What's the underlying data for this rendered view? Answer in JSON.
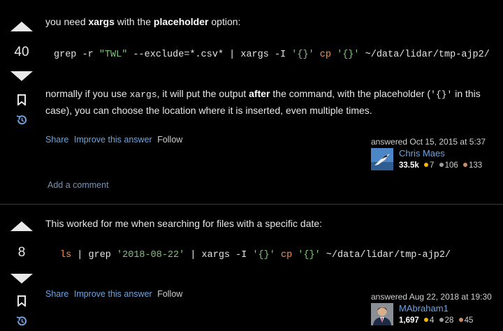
{
  "answers": [
    {
      "votes": "40",
      "intro": {
        "t1": "you need ",
        "b1": "xargs",
        "t2": " with the ",
        "b2": "placeholder",
        "t3": " option:"
      },
      "code": {
        "p1": "grep -r ",
        "s1": "\"TWL\"",
        "p2": " --exclude=*.csv* | xargs -I ",
        "s2": "'{}'",
        "sp": " ",
        "k1": "cp",
        "sp2": " ",
        "s3": "'{}'",
        "p3": " ~/data/lidar/tmp-ajp2/"
      },
      "body": {
        "t1": "normally if you use ",
        "c1": "xargs",
        "t2": ", it will put the output ",
        "b1": "after",
        "t3": " the command, with the placeholder (",
        "c2": "'{}'",
        "t4": " in this case), you can choose the location where it is inserted, even multiple times."
      },
      "menu": {
        "share": "Share",
        "improve": "Improve this answer",
        "follow": "Follow"
      },
      "user": {
        "action": "answered Oct 15, 2015 at 5:37",
        "name": "Chris Maes",
        "rep": "33.5k",
        "gold": "7",
        "silver": "106",
        "bronze": "133"
      },
      "add_comment": "Add a comment"
    },
    {
      "votes": "8",
      "text": "This worked for me when searching for files with a specific date:",
      "code": {
        "k0": "ls",
        "p1": " | grep ",
        "s1": "'2018-08-22'",
        "p2": " | xargs -I ",
        "s2": "'{}'",
        "sp": " ",
        "k1": "cp",
        "sp2": " ",
        "s3": "'{}'",
        "p3": " ~/data/lidar/tmp-ajp2/"
      },
      "menu": {
        "share": "Share",
        "improve": "Improve this answer",
        "follow": "Follow"
      },
      "user": {
        "action": "answered Aug 22, 2018 at 19:30",
        "name": "MAbraham1",
        "rep": "1,697",
        "gold": "4",
        "silver": "28",
        "bronze": "45"
      }
    }
  ],
  "colors": {
    "gold": "#f1b600",
    "silver": "#9a9da0",
    "bronze": "#c88e63",
    "link": "#6fa4e0"
  }
}
